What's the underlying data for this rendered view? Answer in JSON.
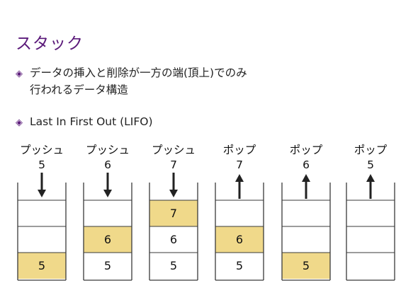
{
  "title": "スタック",
  "bullets": [
    {
      "line1": "データの挿入と削除が一方の端(頂上)でのみ",
      "line2": "行われるデータ構造"
    },
    {
      "line1": "Last In First Out (LIFO)"
    }
  ],
  "highlight_color": "#f0d98a",
  "border_color": "#3a3a3a",
  "stacks": [
    {
      "op": "プッシュ",
      "value": "5",
      "arrow": "down",
      "cells": [
        "",
        "",
        "5"
      ],
      "highlight": 2
    },
    {
      "op": "プッシュ",
      "value": "6",
      "arrow": "down",
      "cells": [
        "",
        "6",
        "5"
      ],
      "highlight": 1
    },
    {
      "op": "プッシュ",
      "value": "7",
      "arrow": "down",
      "cells": [
        "7",
        "6",
        "5"
      ],
      "highlight": 0
    },
    {
      "op": "ポップ",
      "value": "7",
      "arrow": "up",
      "cells": [
        "",
        "6",
        "5"
      ],
      "highlight": 1
    },
    {
      "op": "ポップ",
      "value": "6",
      "arrow": "up",
      "cells": [
        "",
        "",
        "5"
      ],
      "highlight": 2
    },
    {
      "op": "ポップ",
      "value": "5",
      "arrow": "up",
      "cells": [
        "",
        "",
        ""
      ],
      "highlight": -1
    }
  ]
}
